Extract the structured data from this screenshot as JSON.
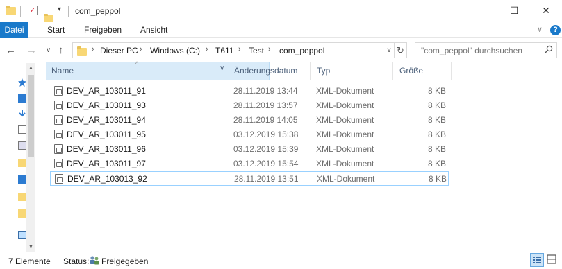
{
  "window": {
    "title": "com_peppol",
    "minimize_glyph": "—",
    "maximize_glyph": "☐",
    "close_glyph": "✕",
    "qa_dropdown_glyph": "▾"
  },
  "ribbon": {
    "tabs": [
      "Datei",
      "Start",
      "Freigeben",
      "Ansicht"
    ],
    "expand_glyph": "∨",
    "help_glyph": "?"
  },
  "navigation": {
    "back_glyph": "←",
    "forward_glyph": "→",
    "recent_glyph": "∨",
    "up_glyph": "↑",
    "breadcrumbs": [
      "Dieser PC",
      "Windows (C:)",
      "T611",
      "Test",
      "com_peppol"
    ],
    "crumb_separator": "›",
    "dropdown_glyph": "∨",
    "refresh_glyph": "↻"
  },
  "search": {
    "placeholder": "\"com_peppol\" durchsuchen"
  },
  "columns": {
    "name": "Name",
    "date": "Änderungsdatum",
    "type": "Typ",
    "size": "Größe",
    "sort_glyph": "^",
    "dropdown_glyph": "∨"
  },
  "files": [
    {
      "name": "DEV_AR_103011_91",
      "date": "28.11.2019 13:44",
      "type": "XML-Dokument",
      "size": "8 KB"
    },
    {
      "name": "DEV_AR_103011_93",
      "date": "28.11.2019 13:57",
      "type": "XML-Dokument",
      "size": "8 KB"
    },
    {
      "name": "DEV_AR_103011_94",
      "date": "28.11.2019 14:05",
      "type": "XML-Dokument",
      "size": "8 KB"
    },
    {
      "name": "DEV_AR_103011_95",
      "date": "03.12.2019 15:38",
      "type": "XML-Dokument",
      "size": "8 KB"
    },
    {
      "name": "DEV_AR_103011_96",
      "date": "03.12.2019 15:39",
      "type": "XML-Dokument",
      "size": "8 KB"
    },
    {
      "name": "DEV_AR_103011_97",
      "date": "03.12.2019 15:54",
      "type": "XML-Dokument",
      "size": "8 KB"
    },
    {
      "name": "DEV_AR_103013_92",
      "date": "28.11.2019 13:51",
      "type": "XML-Dokument",
      "size": "8 KB"
    }
  ],
  "status": {
    "count": "7 Elemente",
    "label": "Status:",
    "sharing": "Freigegeben"
  },
  "colors": {
    "accent": "#1979ca",
    "header_highlight": "#d9ebf9",
    "selection_border": "#99d1ff",
    "folder": "#f8d775"
  }
}
